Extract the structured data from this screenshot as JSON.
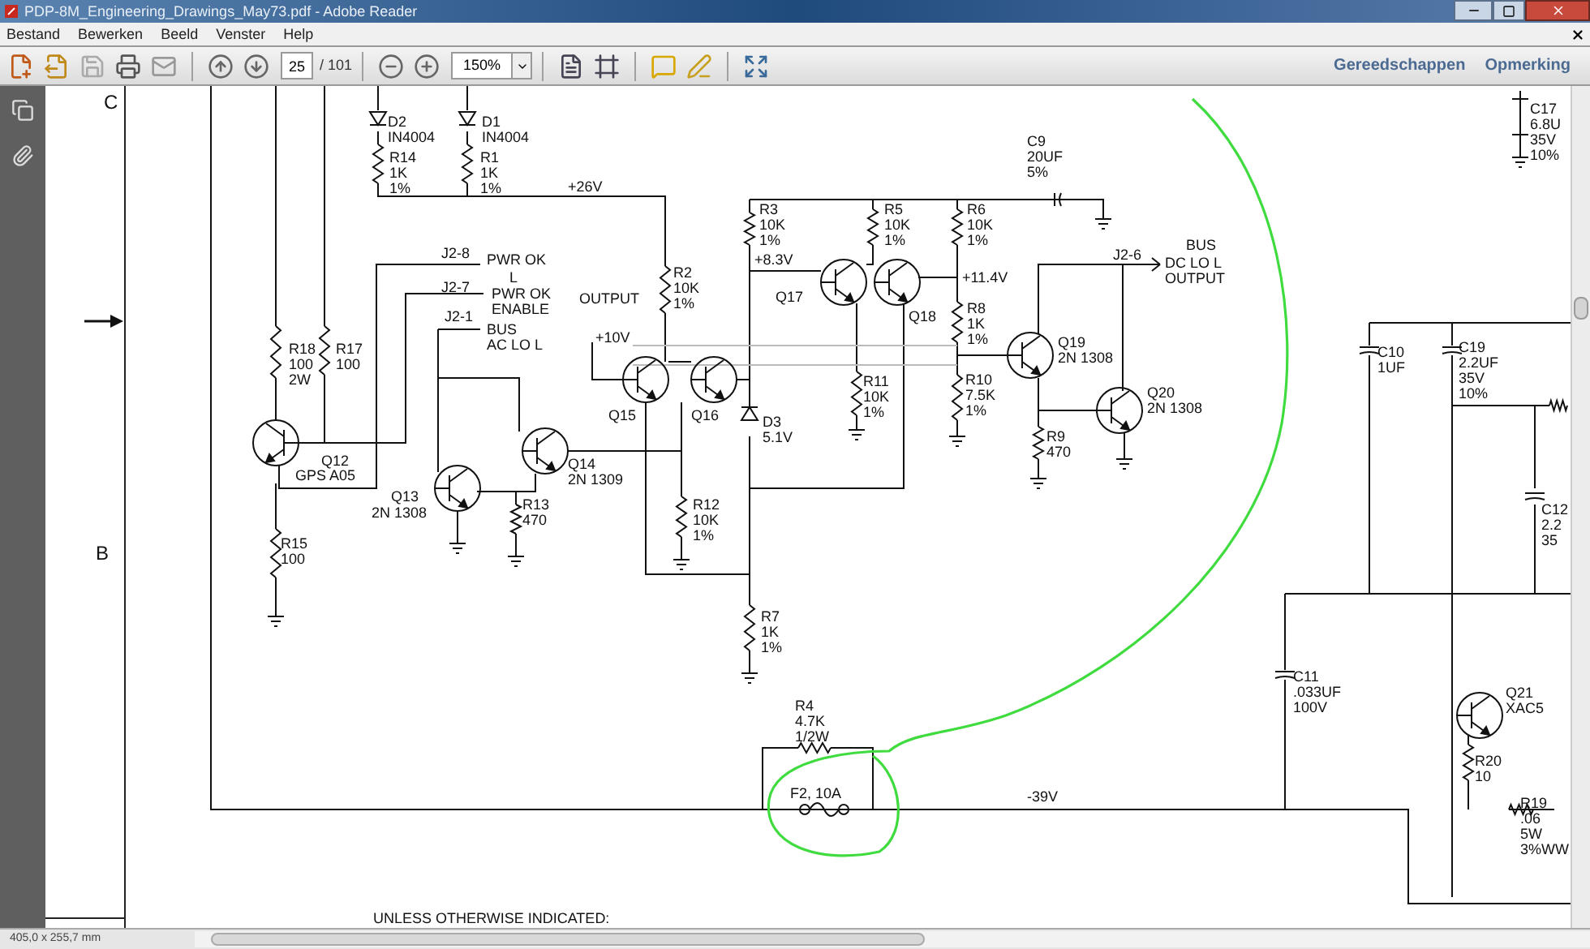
{
  "window": {
    "title": "PDP-8M_Engineering_Drawings_May73.pdf - Adobe Reader"
  },
  "menu": [
    "Bestand",
    "Bewerken",
    "Beeld",
    "Venster",
    "Help"
  ],
  "toolbar": {
    "page": "25",
    "page_count": "/ 101",
    "zoom": "150%"
  },
  "panel_buttons": [
    "Gereedschappen",
    "Opmerking"
  ],
  "sheet": {
    "zones": [
      "C",
      "B"
    ],
    "labels": [
      {
        "lines": [
          "D2",
          "IN4004"
        ]
      },
      {
        "lines": [
          "D1",
          "IN4004"
        ]
      },
      {
        "lines": [
          "R14",
          "1K",
          "1%"
        ]
      },
      {
        "lines": [
          "R1",
          "1K",
          "1%"
        ]
      },
      {
        "lines": [
          "+26V"
        ]
      },
      {
        "lines": [
          "J2-8"
        ]
      },
      {
        "lines": [
          "PWR OK"
        ]
      },
      {
        "lines": [
          "L"
        ]
      },
      {
        "lines": [
          "J2-7"
        ]
      },
      {
        "lines": [
          "PWR OK",
          "ENABLE"
        ]
      },
      {
        "lines": [
          "OUTPUT"
        ]
      },
      {
        "lines": [
          "J2-1"
        ]
      },
      {
        "lines": [
          "BUS",
          "AC LO L"
        ]
      },
      {
        "lines": [
          "R2",
          "10K",
          "1%"
        ]
      },
      {
        "lines": [
          "+10V"
        ]
      },
      {
        "lines": [
          "Q15"
        ]
      },
      {
        "lines": [
          "Q16"
        ]
      },
      {
        "lines": [
          "R18",
          "100",
          "2W"
        ]
      },
      {
        "lines": [
          "R17",
          "100"
        ]
      },
      {
        "lines": [
          "Q12"
        ]
      },
      {
        "lines": [
          "GPS A05"
        ]
      },
      {
        "lines": [
          "Q13"
        ]
      },
      {
        "lines": [
          "2N 1308"
        ]
      },
      {
        "lines": [
          "Q14",
          "2N 1309"
        ]
      },
      {
        "lines": [
          "R13",
          "470"
        ]
      },
      {
        "lines": [
          "R12",
          "10K",
          "1%"
        ]
      },
      {
        "lines": [
          "D3",
          "5.1V"
        ]
      },
      {
        "lines": [
          "R15",
          "100"
        ]
      },
      {
        "lines": [
          "R3",
          "10K",
          "1%"
        ]
      },
      {
        "lines": [
          "R5",
          "10K",
          "1%"
        ]
      },
      {
        "lines": [
          "R6",
          "10K",
          "1%"
        ]
      },
      {
        "lines": [
          "+8.3V"
        ]
      },
      {
        "lines": [
          "Q17"
        ]
      },
      {
        "lines": [
          "Q18"
        ]
      },
      {
        "lines": [
          "+11.4V"
        ]
      },
      {
        "lines": [
          "C9",
          "20UF",
          "5%"
        ]
      },
      {
        "lines": [
          "R8",
          "1K",
          "1%"
        ]
      },
      {
        "lines": [
          "R11",
          "10K",
          "1%"
        ]
      },
      {
        "lines": [
          "R10",
          "7.5K",
          "1%"
        ]
      },
      {
        "lines": [
          "Q19",
          "2N 1308"
        ]
      },
      {
        "lines": [
          "Q20",
          "2N 1308"
        ]
      },
      {
        "lines": [
          "R9",
          "470"
        ]
      },
      {
        "lines": [
          "J2-6"
        ]
      },
      {
        "lines": [
          "BUS"
        ]
      },
      {
        "lines": [
          "DC LO L",
          "OUTPUT"
        ]
      },
      {
        "lines": [
          "R7",
          "1K",
          "1%"
        ]
      },
      {
        "lines": [
          "R4",
          "4.7K",
          "1/2W"
        ]
      },
      {
        "lines": [
          "F2, 10A"
        ]
      },
      {
        "lines": [
          "-39V"
        ]
      },
      {
        "lines": [
          "C17",
          "6.8U",
          "35V",
          "10%"
        ]
      },
      {
        "lines": [
          "C10",
          "1UF"
        ]
      },
      {
        "lines": [
          "C19",
          "2.2UF",
          "35V",
          "10%"
        ]
      },
      {
        "lines": [
          "C12",
          "2.2",
          "35"
        ]
      },
      {
        "lines": [
          "C11",
          ".033UF",
          "100V"
        ]
      },
      {
        "lines": [
          "Q21",
          "XAC5"
        ]
      },
      {
        "lines": [
          "R20",
          "10"
        ]
      },
      {
        "lines": [
          "R19",
          ".06",
          "5W",
          "3%WW"
        ]
      }
    ],
    "note": "UNLESS OTHERWISE INDICATED:"
  },
  "status_bar": {
    "page_size": "405,0 x 255,7 mm"
  }
}
